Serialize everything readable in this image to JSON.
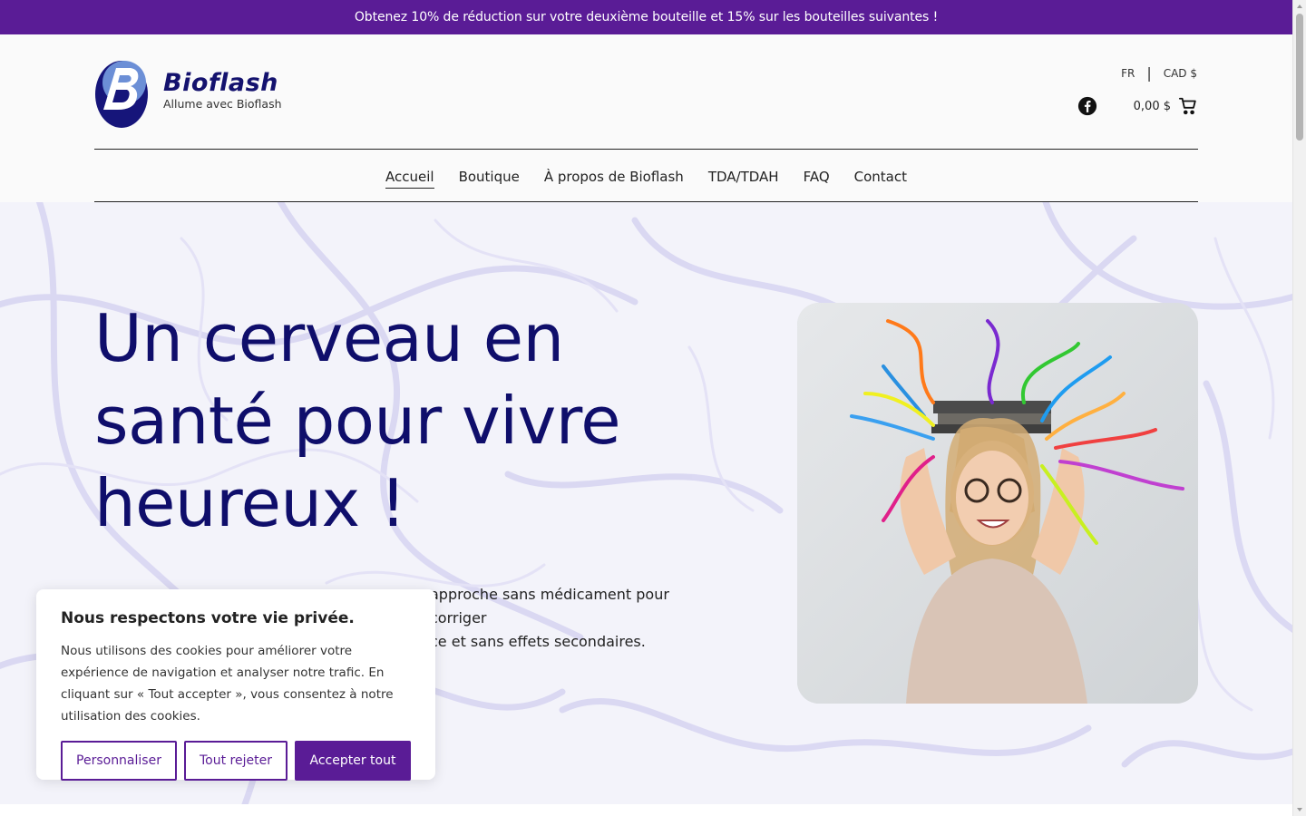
{
  "promo": {
    "text": "Obtenez 10% de réduction sur votre deuxième bouteille et 15% sur les bouteilles suivantes !"
  },
  "brand": {
    "name": "Bioflash",
    "tagline": "Allume avec Bioflash"
  },
  "locale": {
    "language": "FR",
    "currency": "CAD $"
  },
  "cart": {
    "total": "0,00 $"
  },
  "nav": {
    "items": [
      {
        "label": "Accueil",
        "active": true
      },
      {
        "label": "Boutique"
      },
      {
        "label": "À propos de Bioflash"
      },
      {
        "label": "TDA/TDAH"
      },
      {
        "label": "FAQ"
      },
      {
        "label": "Contact"
      }
    ]
  },
  "hero": {
    "title": "Un cerveau en santé pour vivre heureux !",
    "text_visible_line1": "approche sans médicament pour corriger",
    "text_visible_line2": "ce et sans effets secondaires."
  },
  "cookie": {
    "title": "Nous respectons votre vie privée.",
    "body": "Nous utilisons des cookies pour améliorer votre expérience de navigation et analyser notre trafic. En cliquant sur « Tout accepter », vous consentez à notre utilisation des cookies.",
    "customize": "Personnaliser",
    "reject": "Tout rejeter",
    "accept": "Accepter tout"
  },
  "colors": {
    "brand_purple": "#5a1c96",
    "navy": "#0f0e6b",
    "logo_blue": "#1a1a80"
  },
  "icons": [
    "facebook-icon",
    "cart-icon",
    "logo-icon"
  ]
}
